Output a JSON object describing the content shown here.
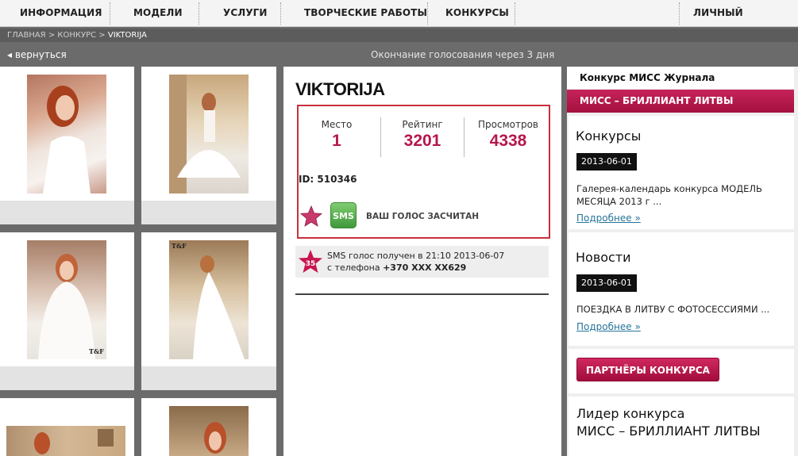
{
  "nav": {
    "items": [
      "ИНФОРМАЦИЯ",
      "МОДЕЛИ",
      "УСЛУГИ",
      "ТВОРЧЕСКИЕ РАБОТЫ",
      "КОНКУРСЫ"
    ],
    "account": "ЛИЧНЫЙ КАБИНЕТ"
  },
  "breadcrumb": {
    "home": "ГЛАВНАЯ",
    "contest": "КОНКУРС",
    "sep": ">",
    "current": "VIKTORIJA"
  },
  "backbar": {
    "back_label": "◂ вернуться",
    "voting_end": "Окончание голосования через 3 дня"
  },
  "gallery": {
    "photos": [
      "photo-1",
      "photo-2",
      "photo-3",
      "photo-4",
      "photo-5",
      "photo-6"
    ],
    "watermark": "T&F"
  },
  "profile": {
    "name": "VIKTORIJA",
    "stats": [
      {
        "label": "Место",
        "value": "1"
      },
      {
        "label": "Рейтинг",
        "value": "3201"
      },
      {
        "label": "Просмотров",
        "value": "4338"
      }
    ],
    "id_text": "ID: 510346",
    "sms_button": "SMS",
    "vote_status": "ВАШ ГОЛОС ЗАСЧИТАН",
    "sms_badge": "35",
    "sms_line1": "SMS голос получен в 21:10  2013-06-07",
    "sms_line2_prefix": "с телефона ",
    "sms_phone": "+370 XXX XX629"
  },
  "sidebar": {
    "contest_label": "Конкурс МИСС Журнала",
    "contest_banner": "МИСС – БРИЛЛИАНТ ЛИТВЫ",
    "contests_title": "Конкурсы",
    "contests_date": "2013-06-01",
    "contests_text": "Галерея-календарь конкурса МОДЕЛЬ МЕСЯЦА 2013 г ...",
    "contests_more": "Подробнее »",
    "news_title": "Новости",
    "news_date": "2013-06-01",
    "news_text": "ПОЕЗДКА В ЛИТВУ С ФОТОСЕССИЯМИ ...",
    "news_more": "Подробнее »",
    "partners_button": "ПАРТНЁРЫ КОНКУРСА",
    "leader_line1": "Лидер конкурса",
    "leader_line2": "МИСС – БРИЛЛИАНТ ЛИТВЫ"
  },
  "colors": {
    "accent": "#b5174e",
    "highlight_border": "#c8303c",
    "sms_green": "#4fa84a",
    "link": "#26759b"
  }
}
